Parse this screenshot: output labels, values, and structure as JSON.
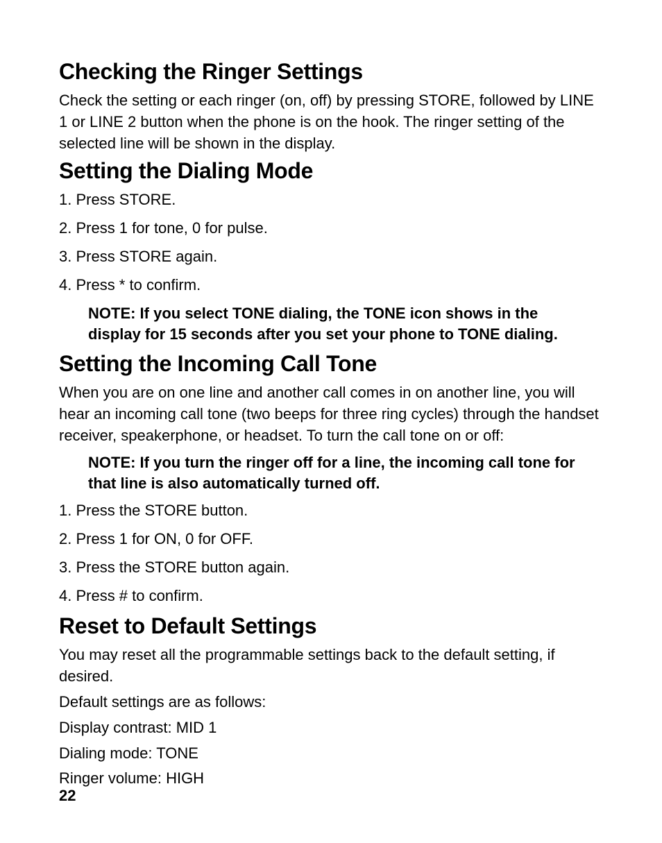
{
  "section1": {
    "heading": "Checking the Ringer Settings",
    "paragraph": "Check the setting or each ringer (on, off) by pressing STORE, followed by LINE 1 or LINE 2 button when the phone is on the hook. The ringer setting of the selected line will be shown in the display."
  },
  "section2": {
    "heading": "Setting the Dialing Mode",
    "items": [
      "1. Press STORE.",
      "2. Press 1 for tone, 0 for pulse.",
      "3. Press STORE again.",
      "4. Press * to confirm."
    ],
    "note": "NOTE: If you select TONE dialing, the TONE icon shows in the display for 15 seconds after you set your phone to TONE dialing."
  },
  "section3": {
    "heading": "Setting the Incoming Call Tone",
    "paragraph": "When you are on one line and another call comes in on another line, you will hear an incoming call tone (two beeps for three ring cycles) through the handset receiver, speakerphone, or headset. To turn the call tone on or off:",
    "note": "NOTE: If you turn the ringer off for a line, the incoming call tone for that line is also automatically turned off.",
    "items": [
      "1. Press the STORE button.",
      "2. Press 1 for ON, 0 for OFF.",
      "3. Press the STORE button again.",
      "4. Press # to confirm."
    ]
  },
  "section4": {
    "heading": "Reset to Default Settings",
    "paragraph1": "You may reset all the programmable settings back to the default setting, if desired.",
    "paragraph2": "Default settings are as follows:",
    "defaults": [
      "Display contrast: MID 1",
      "Dialing mode: TONE",
      "Ringer volume: HIGH"
    ]
  },
  "pageNumber": "22"
}
